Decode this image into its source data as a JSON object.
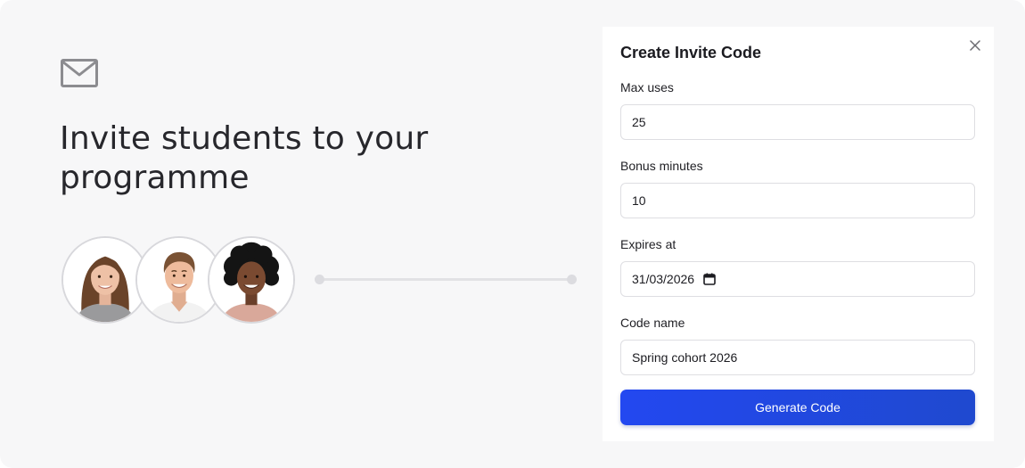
{
  "hero": {
    "headline": "Invite students to your programme",
    "icon": "mail-icon",
    "avatars": [
      "avatar-woman-long-hair",
      "avatar-man-short-hair",
      "avatar-woman-curly-hair"
    ]
  },
  "modal": {
    "title": "Create Invite Code",
    "close_icon": "close-icon",
    "fields": {
      "max_uses": {
        "label": "Max uses",
        "value": "25"
      },
      "bonus_minutes": {
        "label": "Bonus minutes",
        "value": "10"
      },
      "expires_at": {
        "label": "Expires at",
        "value": "31/03/2026"
      },
      "code_name": {
        "label": "Code name",
        "value": "Spring cohort 2026"
      }
    },
    "generate_label": "Generate Code"
  },
  "colors": {
    "accent": "#2348f0",
    "background": "#f7f7f8",
    "panel": "#ffffff"
  }
}
